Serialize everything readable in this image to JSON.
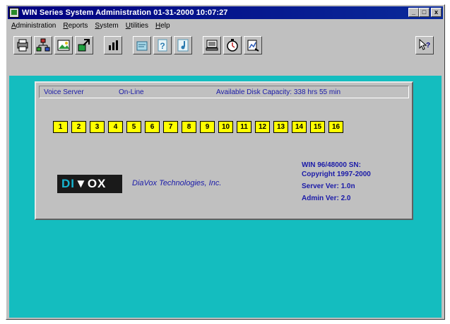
{
  "window": {
    "title": "WIN Series System Administration  01-31-2000 10:07:27",
    "min_label": "_",
    "max_label": "□",
    "close_label": "x"
  },
  "menu": [
    "Administration",
    "Reports",
    "System",
    "Utilities",
    "Help"
  ],
  "toolbar": {
    "icons": [
      "printer-icon",
      "network-icon",
      "image-icon",
      "transfer-icon",
      "bar-chart-icon",
      "open-file-icon",
      "help-question-icon",
      "note-icon",
      "terminal-icon",
      "clock-icon",
      "chart-tool-icon"
    ],
    "help_icon": "context-help-icon"
  },
  "status": {
    "server": "Voice Server",
    "state": "On-Line",
    "capacity": "Available Disk Capacity: 338 hrs 55 min"
  },
  "channels": [
    "1",
    "2",
    "3",
    "4",
    "5",
    "6",
    "7",
    "8",
    "9",
    "10",
    "11",
    "12",
    "13",
    "14",
    "15",
    "16"
  ],
  "logo": {
    "part1": "DI",
    "part2": "▼OX"
  },
  "company": "DiaVox Technologies, Inc.",
  "info": {
    "line1": "WIN 96/48000 SN:",
    "line2": "Copyright 1997-2000",
    "line3": "Server Ver: 1.0n",
    "line4": "Admin Ver:  2.0"
  },
  "colors": {
    "title_bar": "#000080",
    "client_bg": "#14bdbf",
    "channel": "#ffff00",
    "text_blue": "#1a1aa8"
  }
}
